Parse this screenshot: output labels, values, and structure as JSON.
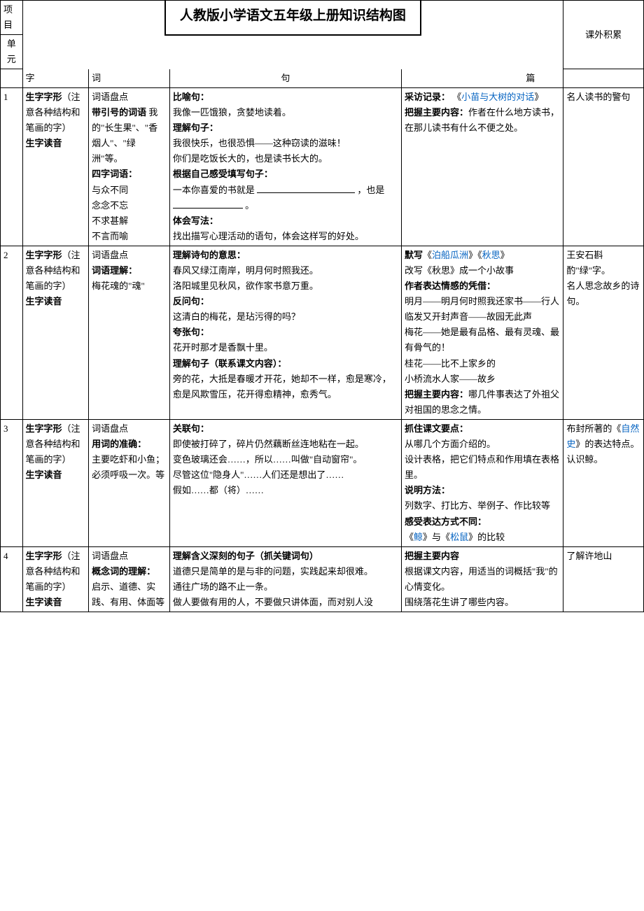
{
  "title": "人教版小学语文五年级上册知识结构图",
  "headers": {
    "project": "项目",
    "unit": "单元",
    "zi": "字",
    "ci": "词",
    "ju": "句",
    "pian": "篇",
    "extra": "课外积累"
  },
  "row1": {
    "unit": "1",
    "zi_b1": "生字字形",
    "zi_t1": "（注意各种结构和笔画的字）",
    "zi_b2": "生字读音",
    "ci_l1": "词语盘点",
    "ci_b1": "带引号的词语",
    "ci_t1": " 我的\"长生果\"、\"香烟人\"、\"绿洲\"等。",
    "ci_b2": "四字词语：",
    "ci_l2": "与众不同",
    "ci_l3": "念念不忘",
    "ci_l4": "不求甚解",
    "ci_l5": "不言而喻",
    "ju_b1": "比喻句：",
    "ju_l1": "我像一匹饿狼，贪婪地读着。",
    "ju_b2": "理解句子：",
    "ju_l2": "我很快乐，也很恐惧——这种窃读的滋味！",
    "ju_l3": "你们是吃饭长大的，也是读书长大的。",
    "ju_b3": "根据自己感受填写句子：",
    "ju_l4a": "一本你喜爱的书就是 ",
    "ju_l4b": " ，也是 ",
    "ju_l4c": " 。",
    "ju_b4": "体会写法：",
    "ju_l5": "找出描写心理活动的语句，体会这样写的好处。",
    "pian_b1": "采访记录：",
    "pian_link1": "小苗与大树的对话",
    "pian_b2": "把握主要内容：",
    "pian_t1": "作者在什么地方读书，在那儿读书有什么不便之处。",
    "extra": "名人读书的警句"
  },
  "row2": {
    "unit": "2",
    "zi_b1": "生字字形",
    "zi_t1": "（注意各种结构和笔画的字）",
    "zi_b2": "生字读音",
    "ci_l1": "词语盘点",
    "ci_b1": "词语理解：",
    "ci_t1": "梅花魂的\"魂\"",
    "ju_b1": "理解诗句的意思：",
    "ju_l1": "春风又绿江南岸，明月何时照我还。",
    "ju_l2": "洛阳城里见秋风，欲作家书意万重。",
    "ju_b2": "反问句：",
    "ju_l3": "这清白的梅花，是玷污得的吗？",
    "ju_b3": "夸张句：",
    "ju_l4": "花开时那才是香飘十里。",
    "ju_b4": "理解句子（联系课文内容）：",
    "ju_l5": "旁的花，大抵是春暖才开花，她却不一样，愈是寒冷，愈是风欺雪压，花开得愈精神，愈秀气。",
    "pian_b1": "默写",
    "pian_link1": "泊船瓜洲",
    "pian_link2": "秋思",
    "pian_l1": "改写《秋思》成一个小故事",
    "pian_b2": "作者表达情感的凭借：",
    "pian_l2": "明月——明月何时照我还家书——行人临发又开封声音——故园无此声",
    "pian_l3": "梅花——她是最有品格、最有灵魂、最有骨气的！",
    "pian_l4": "桂花——比不上家乡的",
    "pian_l5": "小桥流水人家——故乡",
    "pian_b3": "把握主要内容：",
    "pian_t3": "哪几件事表达了外祖父对祖国的思念之情。",
    "extra_l1": "王安石斟酌\"绿\"字。",
    "extra_l2": "名人思念故乡的诗句。"
  },
  "row3": {
    "unit": "3",
    "zi_b1": "生字字形",
    "zi_t1": "（注意各种结构和笔画的字）",
    "zi_b2": "生字读音",
    "ci_l1": "词语盘点",
    "ci_b1": "用词的准确：",
    "ci_t1": "主要吃虾和小鱼；必须呼吸一次。等",
    "ju_b1": "关联句：",
    "ju_l1": "即使被打碎了，碎片仍然藕断丝连地粘在一起。",
    "ju_l2": "变色玻璃还会……，所以……叫做\"自动窗帘\"。",
    "ju_l3": "尽管这位\"隐身人\"……人们还是想出了……",
    "ju_l4": "假如……都（将）……",
    "pian_b1": "抓住课文要点：",
    "pian_l1": "从哪几个方面介绍的。",
    "pian_l2": "设计表格，把它们特点和作用填在表格里。",
    "pian_b2": "说明方法：",
    "pian_l3": "列数字、打比方、举例子、作比较等",
    "pian_b3": "感受表达方式不同：",
    "pian_link1": "鲸",
    "pian_mid": "》与《",
    "pian_link2": "松鼠",
    "pian_end": "》的比较",
    "extra_l1a": "布封所著的《",
    "extra_link": "自然史",
    "extra_l1b": "》的表达特点。",
    "extra_l2": "认识鲸。"
  },
  "row4": {
    "unit": "4",
    "zi_b1": "生字字形",
    "zi_t1": "（注意各种结构和笔画的字）",
    "zi_b2": "生字读音",
    "ci_l1": "词语盘点",
    "ci_b1": "概念词的理解：",
    "ci_t1": "启示、道德、实践、有用、体面等",
    "ju_b1": "理解含义深刻的句子（抓关键词句）",
    "ju_l1": "道德只是简单的是与非的问题，实践起来却很难。",
    "ju_l2": "通往广场的路不止一条。",
    "ju_l3": "做人要做有用的人，不要做只讲体面，而对别人没",
    "pian_b1": "把握主要内容",
    "pian_l1": "根据课文内容，用适当的词概括\"我\"的心情变化。",
    "pian_l2": "围绕落花生讲了哪些内容。",
    "extra": "了解许地山"
  }
}
